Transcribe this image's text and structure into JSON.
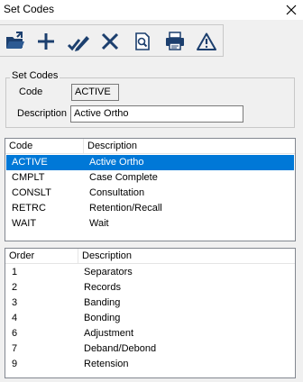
{
  "window": {
    "title": "Set Codes"
  },
  "toolbar": {
    "buttons": [
      {
        "icon": "open-folder-icon"
      },
      {
        "icon": "plus-icon"
      },
      {
        "icon": "edit-check-icon"
      },
      {
        "icon": "delete-x-icon"
      },
      {
        "icon": "preview-icon"
      },
      {
        "icon": "printer-icon"
      },
      {
        "icon": "warning-icon"
      }
    ]
  },
  "form": {
    "group_label": "Set Codes",
    "code_label": "Code",
    "code_value": "ACTIVE",
    "description_label": "Description",
    "description_value": "Active Ortho"
  },
  "codes_list": {
    "columns": [
      "Code",
      "Description"
    ],
    "rows": [
      {
        "code": "ACTIVE",
        "description": "Active Ortho",
        "selected": true
      },
      {
        "code": "CMPLT",
        "description": "Case Complete"
      },
      {
        "code": "CONSLT",
        "description": "Consultation"
      },
      {
        "code": "RETRC",
        "description": "Retention/Recall"
      },
      {
        "code": "WAIT",
        "description": "Wait"
      }
    ]
  },
  "order_list": {
    "columns": [
      "Order",
      "Description"
    ],
    "rows": [
      {
        "order": "1",
        "description": "Separators"
      },
      {
        "order": "2",
        "description": "Records"
      },
      {
        "order": "3",
        "description": "Banding"
      },
      {
        "order": "4",
        "description": "Bonding"
      },
      {
        "order": "6",
        "description": "Adjustment"
      },
      {
        "order": "7",
        "description": "Deband/Debond"
      },
      {
        "order": "9",
        "description": "Retension"
      }
    ]
  },
  "colors": {
    "selection": "#0078d7",
    "icon": "#1c3f6e"
  }
}
